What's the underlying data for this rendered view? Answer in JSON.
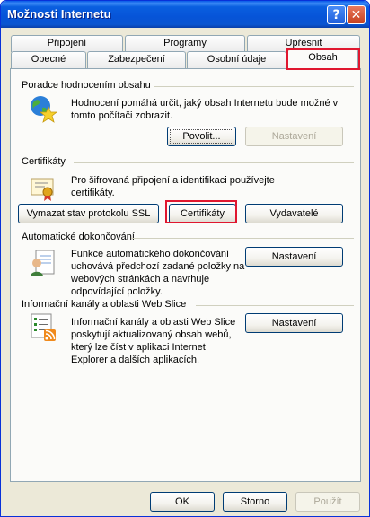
{
  "window": {
    "title": "Možnosti Internetu",
    "help_glyph": "?",
    "close_glyph": "✕"
  },
  "tabs": {
    "top_row": [
      "Připojení",
      "Programy",
      "Upřesnit"
    ],
    "bottom_row": [
      "Obecné",
      "Zabezpečení",
      "Osobní údaje",
      "Obsah"
    ],
    "active": "Obsah"
  },
  "content_advisor": {
    "title": "Poradce hodnocením obsahu",
    "description_line1": "Hodnocení pomáhá určit, jaký obsah Internetu bude možné v",
    "description_line2": "tomto počítači zobrazit.",
    "enable_button": "Povolit...",
    "settings_button": "Nastavení",
    "icon": "globe-star-icon"
  },
  "certificates": {
    "title": "Certifikáty",
    "description_line1": "Pro šifrovaná připojení a identifikaci používejte",
    "description_line2": "certifikáty.",
    "clear_ssl_button": "Vymazat stav protokolu SSL",
    "certificates_button": "Certifikáty",
    "publishers_button": "Vydavatelé",
    "icon": "certificate-icon"
  },
  "autocomplete": {
    "title": "Automatické dokončování",
    "description_line1": "Funkce automatického dokončování",
    "description_line2": "uchovává předchozí zadané položky na",
    "description_line3": "webových stránkách a navrhuje",
    "description_line4": "odpovídající položky.",
    "settings_button": "Nastavení",
    "icon": "autocomplete-user-icon"
  },
  "feeds": {
    "title": "Informační kanály a oblasti Web Slice",
    "description_line1": "Informační kanály a oblasti Web Slice",
    "description_line2": "poskytují aktualizovaný obsah webů,",
    "description_line3": "který lze číst v aplikaci Internet",
    "description_line4": "Explorer a dalších aplikacích.",
    "settings_button": "Nastavení",
    "icon": "feeds-list-icon"
  },
  "footer": {
    "ok_button": "OK",
    "cancel_button": "Storno",
    "apply_button": "Použít"
  },
  "colors": {
    "highlight_red": "#e0172f",
    "title_blue": "#0654d8",
    "dialog_bg": "#ece9d8"
  }
}
